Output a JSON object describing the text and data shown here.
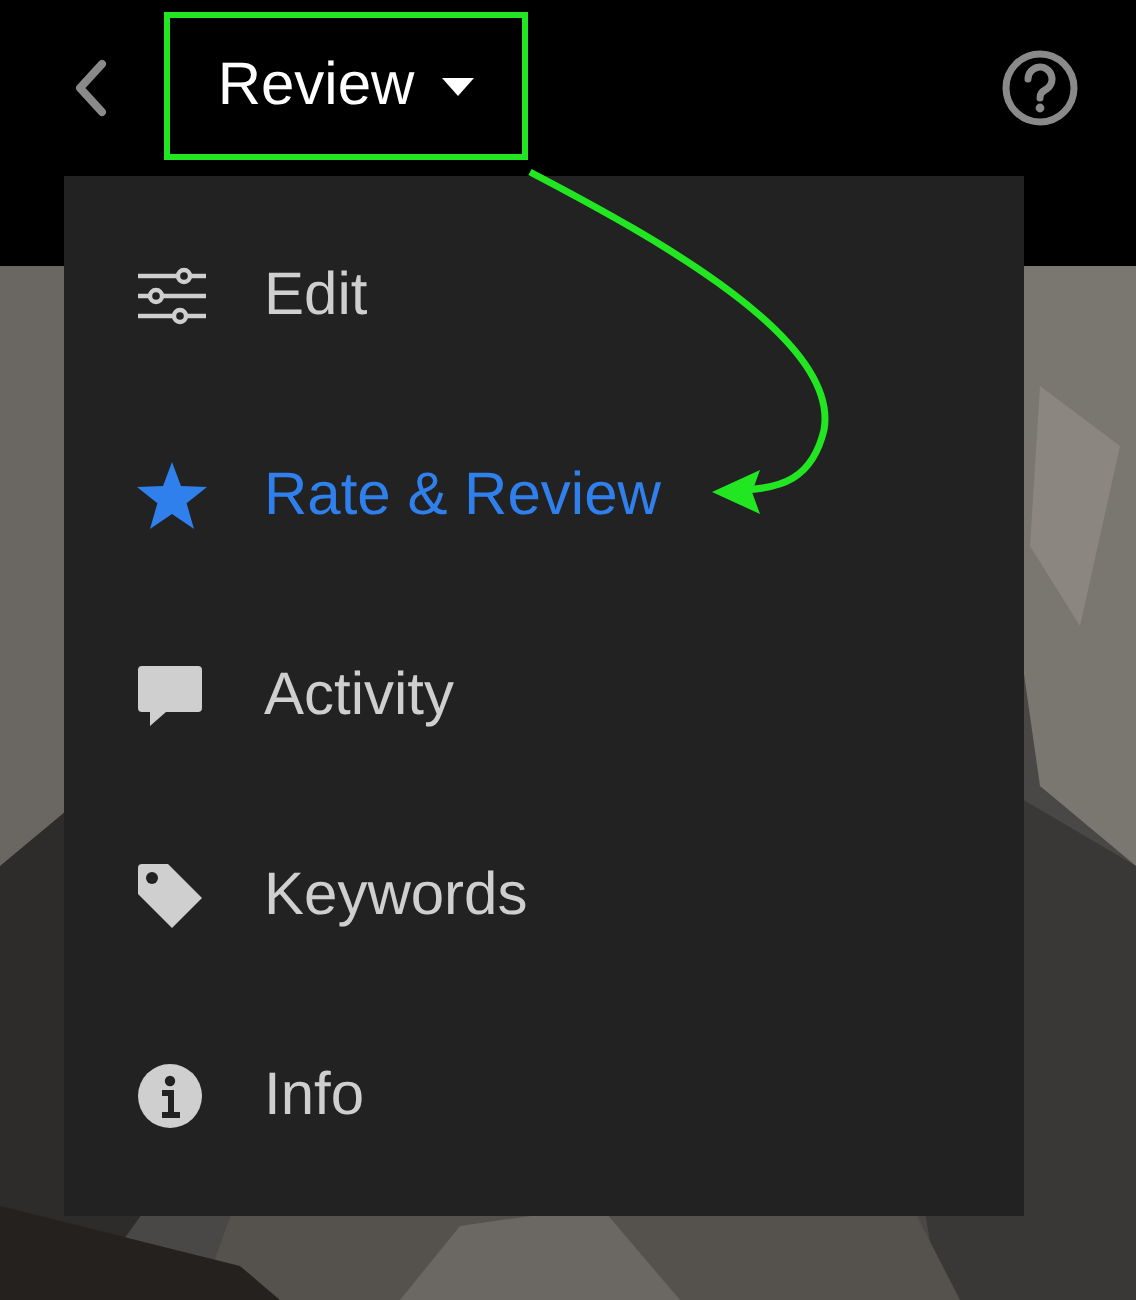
{
  "header": {
    "title": "Review"
  },
  "menu": {
    "items": [
      {
        "label": "Edit",
        "kind": "sliders",
        "selected": false
      },
      {
        "label": "Rate & Review",
        "kind": "star",
        "selected": true
      },
      {
        "label": "Activity",
        "kind": "comment",
        "selected": false
      },
      {
        "label": "Keywords",
        "kind": "tag",
        "selected": false
      },
      {
        "label": "Info",
        "kind": "info",
        "selected": false
      }
    ]
  }
}
